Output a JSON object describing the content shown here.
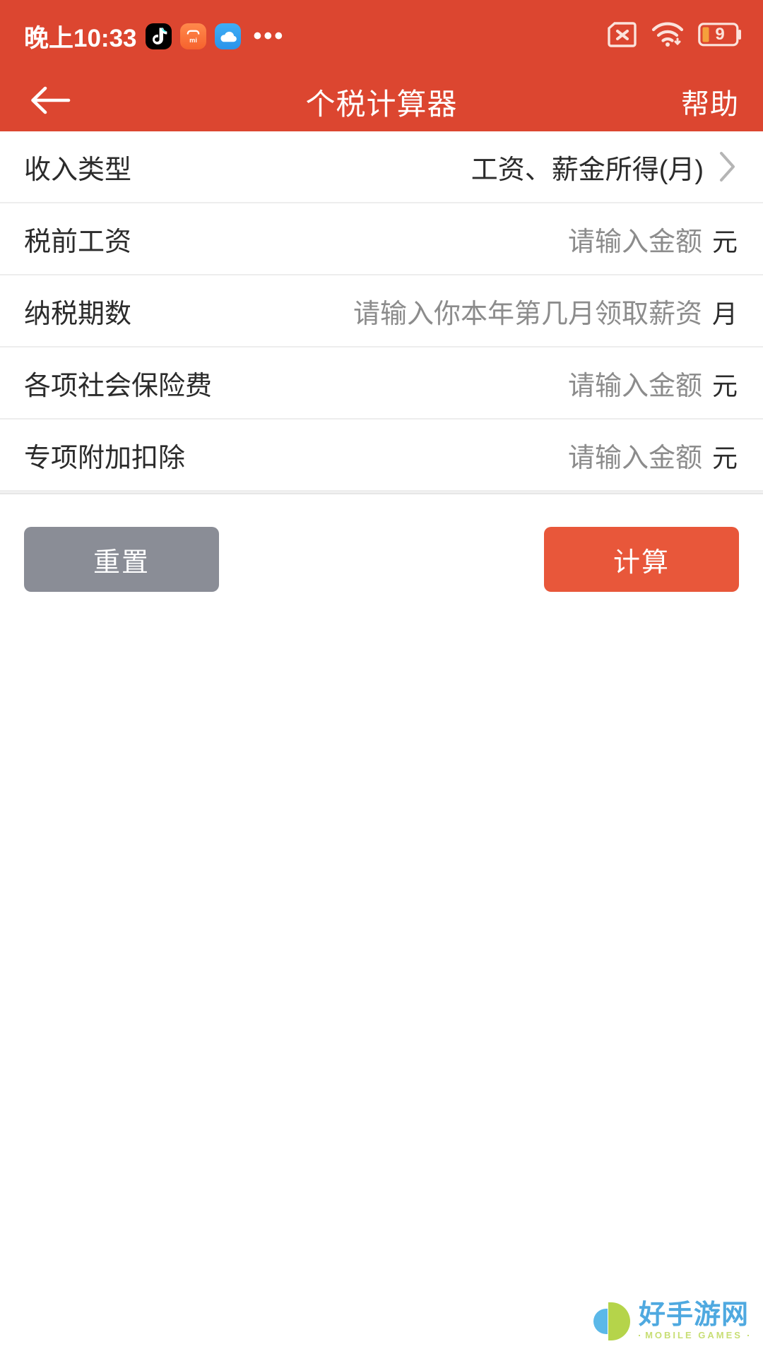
{
  "theme": {
    "header_bg": "#DC4630",
    "accent": "#E8573A",
    "reset_bg": "#8A8D96",
    "text_primary": "#2B2B2B",
    "text_placeholder": "#8C8C8C",
    "divider": "#EDEDED"
  },
  "status_bar": {
    "time": "晚上10:33",
    "notification_icons": [
      "tiktok-icon",
      "mi-store-icon",
      "cloud-icon"
    ],
    "more_indicator": "•••",
    "sim_status": "no-sim-icon",
    "wifi": "wifi-icon",
    "battery_level": "9"
  },
  "navbar": {
    "back": "back-arrow-icon",
    "title": "个税计算器",
    "help_label": "帮助"
  },
  "form": {
    "rows": [
      {
        "label": "收入类型",
        "type": "select",
        "value": "工资、薪金所得(月)",
        "placeholder": "",
        "unit": "",
        "chevron": true
      },
      {
        "label": "税前工资",
        "type": "input",
        "value": "",
        "placeholder": "请输入金额",
        "unit": "元",
        "chevron": false
      },
      {
        "label": "纳税期数",
        "type": "input",
        "value": "",
        "placeholder": "请输入你本年第几月领取薪资",
        "unit": "月",
        "chevron": false
      },
      {
        "label": "各项社会保险费",
        "type": "input",
        "value": "",
        "placeholder": "请输入金额",
        "unit": "元",
        "chevron": false
      },
      {
        "label": "专项附加扣除",
        "type": "input",
        "value": "",
        "placeholder": "请输入金额",
        "unit": "元",
        "chevron": false
      }
    ]
  },
  "actions": {
    "reset_label": "重置",
    "calculate_label": "计算"
  },
  "watermark": {
    "brand_cn": "好手游网",
    "brand_en": "MOBILE GAMES"
  }
}
